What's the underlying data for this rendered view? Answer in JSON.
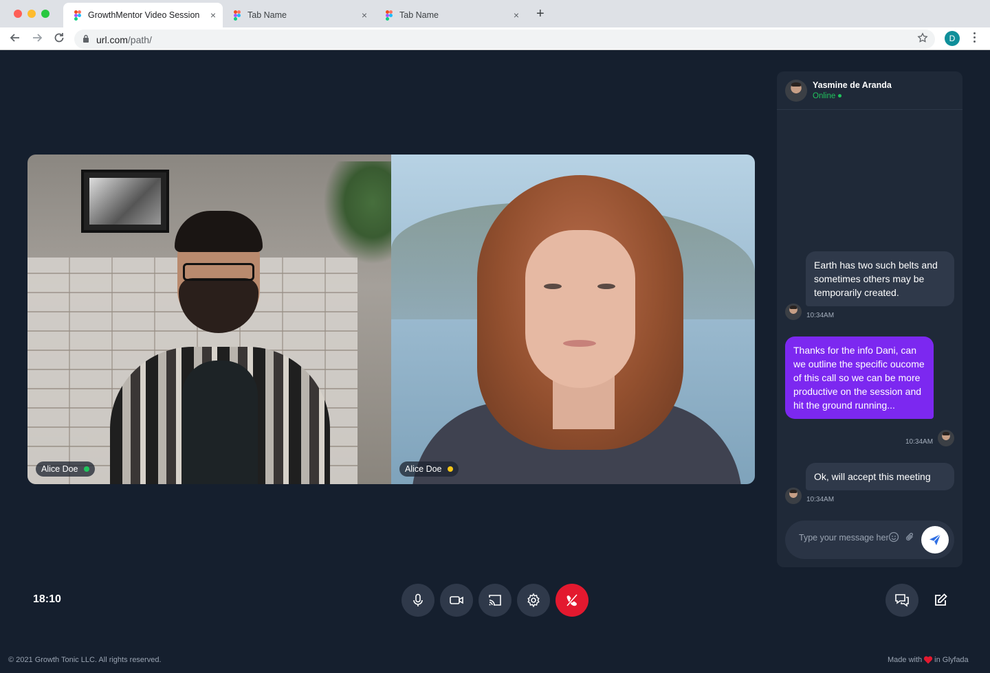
{
  "browser": {
    "tabs": [
      {
        "title": "GrowthMentor Video Session",
        "active": true
      },
      {
        "title": "Tab Name",
        "active": false
      },
      {
        "title": "Tab Name",
        "active": false
      }
    ],
    "close_glyph": "×",
    "new_tab_glyph": "+",
    "url_host": "url.com",
    "url_path": "/path/",
    "profile_initial": "D"
  },
  "video": {
    "participants": [
      {
        "name": "Alice Doe",
        "status_color": "#21c45d"
      },
      {
        "name": "Alice Doe",
        "status_color": "#f5c518"
      }
    ]
  },
  "chat": {
    "contact_name": "Yasmine de Aranda",
    "contact_status": "Online",
    "messages": [
      {
        "direction": "in",
        "text": "Earth has two such belts and sometimes others may be temporarily created.",
        "time": "10:34AM"
      },
      {
        "direction": "out",
        "text": "Thanks for the info Dani, can we outline the specific oucome of this call so we can be more productive on the session and hit the ground running...",
        "time": "10:34AM"
      },
      {
        "direction": "in",
        "text": "Ok, will accept this meeting",
        "time": "10:34AM"
      }
    ],
    "composer_placeholder": "Type your message here..."
  },
  "controls": {
    "timer": "18:10",
    "buttons": [
      "microphone",
      "camera",
      "screen-share",
      "settings",
      "end-call"
    ],
    "right_buttons": [
      "chat",
      "notes"
    ]
  },
  "footer": {
    "copyright": "© 2021 Growth Tonic LLC. All rights reserved.",
    "made_with": "Made with",
    "made_in": "in Glyfada"
  },
  "colors": {
    "background": "#151f2e",
    "panel": "#1f2938",
    "accent_purple": "#7c28f0",
    "end_call_red": "#e3192f",
    "online_green": "#21c45d"
  }
}
